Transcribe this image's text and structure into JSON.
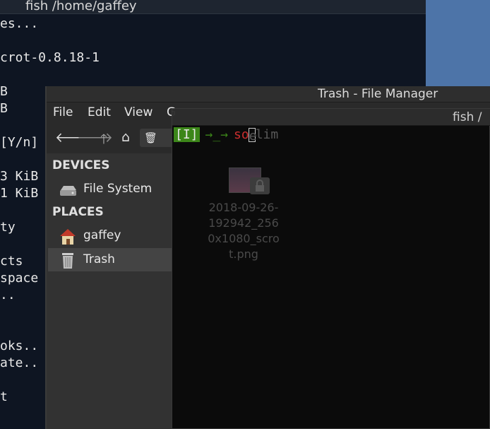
{
  "back_terminal": {
    "title": "fish  /home/gaffey",
    "lines": [
      {
        "text": "es..."
      },
      {
        "text": ""
      },
      {
        "text": "crot-0.8.18-1"
      },
      {
        "text": ""
      },
      {
        "text": "B"
      },
      {
        "text": "B"
      },
      {
        "text": ""
      },
      {
        "text": "[Y/n]"
      },
      {
        "text": ""
      },
      {
        "text": "3 KiB"
      },
      {
        "text": "1 KiB"
      },
      {
        "text": ""
      },
      {
        "text": "ty"
      },
      {
        "text": ""
      },
      {
        "text": "cts"
      },
      {
        "text": "space"
      },
      {
        "text": ".."
      },
      {
        "text": ""
      },
      {
        "text": ""
      },
      {
        "text": "oks.."
      },
      {
        "text": "ate.."
      },
      {
        "text": ""
      },
      {
        "text": "t"
      }
    ]
  },
  "file_manager": {
    "title": "Trash - File Manager",
    "menu": [
      "File",
      "Edit",
      "View",
      "G"
    ],
    "path_text": "trash",
    "sidebar": {
      "devices_heading": "DEVICES",
      "places_heading": "PLACES",
      "items": [
        {
          "label": "File System",
          "icon": "harddisk-icon"
        },
        {
          "label": "gaffey",
          "icon": "home-folder-icon"
        },
        {
          "label": "Trash",
          "icon": "trash-icon"
        }
      ]
    },
    "file": {
      "name": "2018-09-26-\n192942_256\n0x1080_scro\nt.png"
    }
  },
  "front_terminal": {
    "title": "fish  /",
    "mode": "[I]",
    "arrows": "→_→",
    "typed": "so",
    "cursor_char": "e",
    "suggestion": "lim"
  },
  "colors": {
    "terminal_bg": "#0e1522",
    "mode_green": "#3d8a19",
    "typed_red": "#d22f2f",
    "desktop_blue": "#4d74a8"
  }
}
